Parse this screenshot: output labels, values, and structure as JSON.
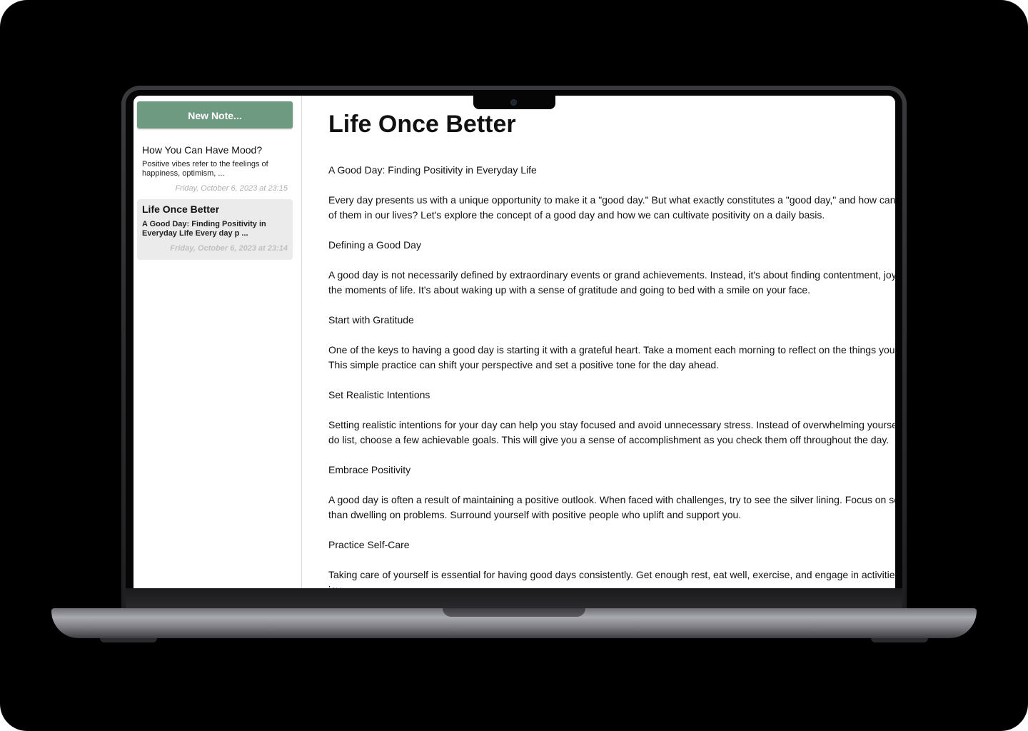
{
  "sidebar": {
    "new_note_label": "New Note...",
    "notes": [
      {
        "title": "How You Can Have Mood?",
        "preview": "Positive vibes refer to the feelings of happiness, optimism, ...",
        "date": "Friday, October 6, 2023 at 23:15",
        "selected": false
      },
      {
        "title": "Life Once Better",
        "preview": "A Good Day: Finding Positivity in Everyday Life Every day p ...",
        "date": "Friday, October 6, 2023 at 23:14",
        "selected": true
      }
    ]
  },
  "document": {
    "title": "Life Once Better",
    "paragraphs": [
      "A Good Day: Finding Positivity in Everyday Life",
      "Every day presents us with a unique opportunity to make it a \"good day.\" But what exactly constitutes a \"good day,\" and how can we bring more of them in our lives? Let's explore the concept of a good day and how we can cultivate positivity on a daily basis.",
      "Defining a Good Day",
      "A good day is not necessarily defined by extraordinary events or grand achievements. Instead, it's about finding contentment, joy, and meaning in the moments of life. It's about waking up with a sense of gratitude and going to bed with a smile on your face.",
      "Start with Gratitude",
      "One of the keys to having a good day is starting it with a grateful heart. Take a moment each morning to reflect on the things you are grateful for. This simple practice can shift your perspective and set a positive tone for the day ahead.",
      "Set Realistic Intentions",
      "Setting realistic intentions for your day can help you stay focused and avoid unnecessary stress. Instead of overwhelming yourself with a long to-do list, choose a few achievable goals. This will give you a sense of accomplishment as you check them off throughout the day.",
      "Embrace Positivity",
      "A good day is often a result of maintaining a positive outlook. When faced with challenges, try to see the silver lining. Focus on solutions rather than dwelling on problems. Surround yourself with positive people who uplift and support you.",
      "Practice Self-Care",
      "Taking care of yourself is essential for having good days consistently. Get enough rest, eat well, exercise, and engage in activities that bring you joy."
    ]
  }
}
